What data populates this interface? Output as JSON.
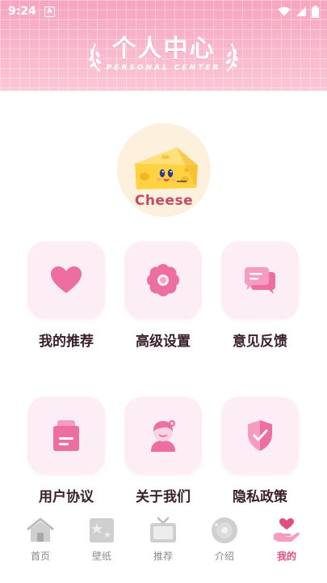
{
  "status_bar": {
    "time": "9:24",
    "notification_glyph": "A"
  },
  "header": {
    "title": "个人中心",
    "subtitle": "PERSONAL CENTER"
  },
  "avatar": {
    "label": "Cheese",
    "icon": "cheese-icon"
  },
  "grid": [
    {
      "label": "我的推荐",
      "icon": "heart-icon"
    },
    {
      "label": "高级设置",
      "icon": "flower-icon"
    },
    {
      "label": "意见反馈",
      "icon": "chat-icon"
    },
    {
      "label": "用户协议",
      "icon": "document-icon"
    },
    {
      "label": "关于我们",
      "icon": "person-icon"
    },
    {
      "label": "隐私政策",
      "icon": "shield-icon"
    }
  ],
  "bottom_nav": [
    {
      "label": "首页",
      "icon": "home-icon",
      "active": false
    },
    {
      "label": "壁纸",
      "icon": "wallpaper-icon",
      "active": false
    },
    {
      "label": "推荐",
      "icon": "tv-icon",
      "active": false
    },
    {
      "label": "介绍",
      "icon": "disc-icon",
      "active": false
    },
    {
      "label": "我的",
      "icon": "hand-heart-icon",
      "active": true
    }
  ],
  "colors": {
    "header_pink": "#f9b3c9",
    "tile_bg": "#fdeef6",
    "icon_pink": "#ec6fa0",
    "active_tab": "#e04f82",
    "inactive_tab": "#8a8a8a"
  }
}
